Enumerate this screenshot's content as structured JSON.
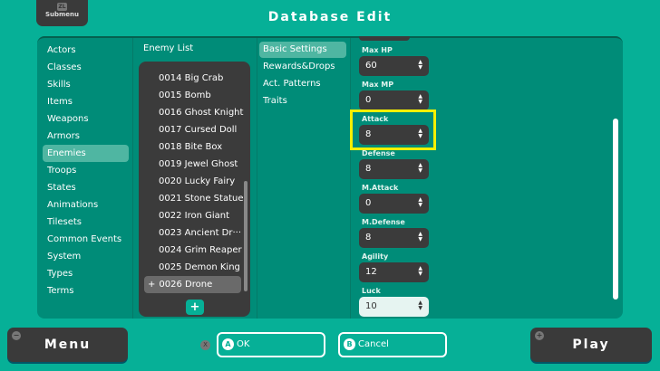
{
  "header": {
    "submenu_key": "ZL",
    "submenu_label": "Submenu",
    "title": "Database Edit"
  },
  "categories": [
    "Actors",
    "Classes",
    "Skills",
    "Items",
    "Weapons",
    "Armors",
    "Enemies",
    "Troops",
    "States",
    "Animations",
    "Tilesets",
    "Common Events",
    "System",
    "Types",
    "Terms"
  ],
  "selected_category": "Enemies",
  "enemy_list": {
    "title": "Enemy List",
    "items": [
      "0014 Big Crab",
      "0015 Bomb",
      "0016 Ghost Knight",
      "0017 Cursed Doll",
      "0018 Bite Box",
      "0019 Jewel Ghost",
      "0020 Lucky Fairy",
      "0021 Stone Statue",
      "0022 Iron Giant",
      "0023 Ancient Dr···",
      "0024 Grim Reaper",
      "0025 Demon King",
      "0026 Drone"
    ],
    "selected_marker": "+",
    "add_label": "+"
  },
  "tabs": [
    "Basic Settings",
    "Rewards&Drops",
    "Act. Patterns",
    "Traits"
  ],
  "fields": [
    {
      "label": "Max HP",
      "value": "60"
    },
    {
      "label": "Max MP",
      "value": "0"
    },
    {
      "label": "Attack",
      "value": "8"
    },
    {
      "label": "Defense",
      "value": "8"
    },
    {
      "label": "M.Attack",
      "value": "0"
    },
    {
      "label": "M.Defense",
      "value": "8"
    },
    {
      "label": "Agility",
      "value": "12"
    },
    {
      "label": "Luck",
      "value": "10"
    }
  ],
  "highlight_color": "#f5f000",
  "footer": {
    "menu_key": "−",
    "menu_label": "Menu",
    "x_key": "X",
    "ok_key": "A",
    "ok_label": "OK",
    "cancel_key": "B",
    "cancel_label": "Cancel",
    "play_key": "+",
    "play_label": "Play"
  }
}
